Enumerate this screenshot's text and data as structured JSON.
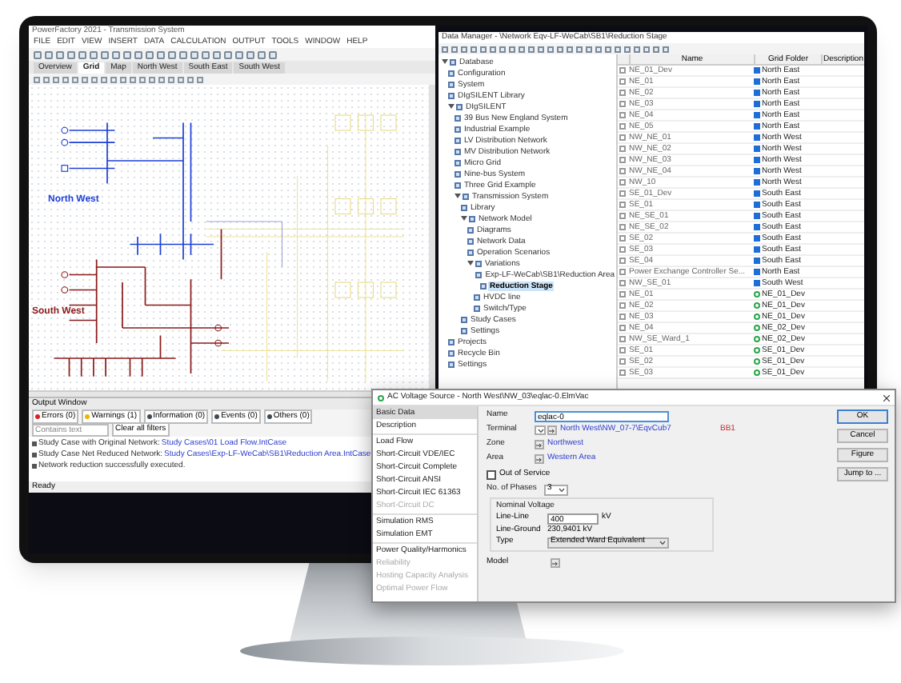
{
  "main_window": {
    "title": "PowerFactory 2021 - Transmission System",
    "menu": [
      "FILE",
      "EDIT",
      "VIEW",
      "INSERT",
      "DATA",
      "CALCULATION",
      "OUTPUT",
      "TOOLS",
      "WINDOW",
      "HELP"
    ],
    "tabs": [
      {
        "label": "Overview",
        "selected": false
      },
      {
        "label": "Grid",
        "selected": true
      },
      {
        "label": "Map",
        "selected": false
      },
      {
        "label": "North West",
        "selected": false
      },
      {
        "label": "South East",
        "selected": false
      },
      {
        "label": "South West",
        "selected": false
      }
    ],
    "diagram_labels": [
      {
        "text": "North West",
        "color": "#1d3fd6"
      },
      {
        "text": "South West",
        "color": "#8b1a1a"
      }
    ],
    "output": {
      "title": "Output Window",
      "filters": [
        {
          "label": "Errors (0)",
          "color": "#e02020"
        },
        {
          "label": "Warnings (1)",
          "color": "#f0b400"
        },
        {
          "label": "Information (0)",
          "color": "#404a55"
        },
        {
          "label": "Events (0)",
          "color": "#404a55"
        },
        {
          "label": "Others (0)",
          "color": "#404a55"
        }
      ],
      "search_placeholder": "Contains text",
      "clear": "Clear all filters",
      "lines": [
        {
          "text": "Study Case with Original Network:",
          "link": "Study Cases\\01 Load Flow.IntCase"
        },
        {
          "text": "Study Case Net Reduced Network:",
          "link": "Study Cases\\Exp-LF-WeCab\\SB1\\Reduction Area.IntCase"
        },
        {
          "text": "Network reduction successfully executed."
        }
      ],
      "status": "Ready"
    }
  },
  "data_manager": {
    "title": "Data Manager - \\Network Eqv-LF-WeCab\\SB1\\Reduction Stage",
    "tree": [
      {
        "label": "Database",
        "expanded": true,
        "children": [
          {
            "label": "Configuration"
          },
          {
            "label": "System"
          },
          {
            "label": "DIgSILENT Library"
          },
          {
            "label": "DIgSILENT",
            "expanded": true,
            "children": [
              {
                "label": "39 Bus New England System"
              },
              {
                "label": "Industrial Example"
              },
              {
                "label": "LV Distribution Network"
              },
              {
                "label": "MV Distribution Network"
              },
              {
                "label": "Micro Grid"
              },
              {
                "label": "Nine-bus System"
              },
              {
                "label": "Three Grid Example"
              },
              {
                "label": "Transmission System",
                "expanded": true,
                "children": [
                  {
                    "label": "Library"
                  },
                  {
                    "label": "Network Model",
                    "expanded": true,
                    "children": [
                      {
                        "label": "Diagrams"
                      },
                      {
                        "label": "Network Data"
                      },
                      {
                        "label": "Operation Scenarios"
                      },
                      {
                        "label": "Variations",
                        "expanded": true,
                        "children": [
                          {
                            "label": "Exp-LF-WeCab\\SB1\\Reduction Area",
                            "expanded": true,
                            "children": [
                              {
                                "label": "Reduction Stage",
                                "selected": true
                              }
                            ]
                          },
                          {
                            "label": "HVDC line"
                          },
                          {
                            "label": "Switch/Type"
                          }
                        ]
                      }
                    ]
                  },
                  {
                    "label": "Study Cases"
                  },
                  {
                    "label": "Settings"
                  }
                ]
              }
            ]
          },
          {
            "label": "Projects"
          },
          {
            "label": "Recycle Bin"
          },
          {
            "label": "Settings"
          }
        ]
      }
    ],
    "columns": [
      "Name",
      "Grid Folder",
      "Description"
    ],
    "rows": [
      {
        "name": "NE_01_Dev",
        "folder": "North East",
        "kind": "grid"
      },
      {
        "name": "NE_01",
        "folder": "North East",
        "kind": "grid"
      },
      {
        "name": "NE_02",
        "folder": "North East",
        "kind": "grid"
      },
      {
        "name": "NE_03",
        "folder": "North East",
        "kind": "grid"
      },
      {
        "name": "NE_04",
        "folder": "North East",
        "kind": "grid"
      },
      {
        "name": "NE_05",
        "folder": "North East",
        "kind": "grid"
      },
      {
        "name": "NW_NE_01",
        "folder": "North West",
        "kind": "grid"
      },
      {
        "name": "NW_NE_02",
        "folder": "North West",
        "kind": "grid"
      },
      {
        "name": "NW_NE_03",
        "folder": "North West",
        "kind": "grid"
      },
      {
        "name": "NW_NE_04",
        "folder": "North West",
        "kind": "grid"
      },
      {
        "name": "NW_10",
        "folder": "North West",
        "kind": "grid"
      },
      {
        "name": "SE_01_Dev",
        "folder": "South East",
        "kind": "grid"
      },
      {
        "name": "SE_01",
        "folder": "South East",
        "kind": "grid"
      },
      {
        "name": "NE_SE_01",
        "folder": "South East",
        "kind": "grid"
      },
      {
        "name": "NE_SE_02",
        "folder": "South East",
        "kind": "grid"
      },
      {
        "name": "SE_02",
        "folder": "South East",
        "kind": "grid"
      },
      {
        "name": "SE_03",
        "folder": "South East",
        "kind": "grid"
      },
      {
        "name": "SE_04",
        "folder": "South East",
        "kind": "grid"
      },
      {
        "name": "Power Exchange Controller Se...",
        "folder": "North East",
        "kind": "grid"
      },
      {
        "name": "NW_SE_01",
        "folder": "South West",
        "kind": "grid"
      },
      {
        "name": "NE_01",
        "folder": "NE_01_Dev",
        "kind": "variant"
      },
      {
        "name": "NE_02",
        "folder": "NE_01_Dev",
        "kind": "variant"
      },
      {
        "name": "NE_03",
        "folder": "NE_01_Dev",
        "kind": "variant"
      },
      {
        "name": "NE_04",
        "folder": "NE_02_Dev",
        "kind": "variant"
      },
      {
        "name": "NW_SE_Ward_1",
        "folder": "NE_02_Dev",
        "kind": "variant"
      },
      {
        "name": "SE_01",
        "folder": "SE_01_Dev",
        "kind": "variant"
      },
      {
        "name": "SE_02",
        "folder": "SE_01_Dev",
        "kind": "variant"
      },
      {
        "name": "SE_03",
        "folder": "SE_01_Dev",
        "kind": "variant"
      }
    ]
  },
  "dialog": {
    "title": "AC Voltage Source - North West\\NW_03\\eqlac-0.ElmVac",
    "nav": [
      {
        "label": "Basic Data",
        "selected": true,
        "disabled": false
      },
      {
        "label": "Description",
        "selected": false,
        "disabled": false
      },
      {
        "label": "Load Flow",
        "selected": false,
        "disabled": false
      },
      {
        "label": "Short-Circuit VDE/IEC",
        "selected": false,
        "disabled": false
      },
      {
        "label": "Short-Circuit Complete",
        "selected": false,
        "disabled": false
      },
      {
        "label": "Short-Circuit ANSI",
        "selected": false,
        "disabled": false
      },
      {
        "label": "Short-Circuit IEC 61363",
        "selected": false,
        "disabled": false
      },
      {
        "label": "Short-Circuit DC",
        "selected": false,
        "disabled": true
      },
      {
        "label": "Simulation RMS",
        "selected": false,
        "disabled": false
      },
      {
        "label": "Simulation EMT",
        "selected": false,
        "disabled": false
      },
      {
        "label": "Power Quality/Harmonics",
        "selected": false,
        "disabled": false
      },
      {
        "label": "Reliability",
        "selected": false,
        "disabled": true
      },
      {
        "label": "Hosting Capacity Analysis",
        "selected": false,
        "disabled": true
      },
      {
        "label": "Optimal Power Flow",
        "selected": false,
        "disabled": true
      }
    ],
    "name": {
      "label": "Name",
      "value": "eqlac-0"
    },
    "terminal": {
      "label": "Terminal",
      "value": "North West\\NW_07-7\\EqvCub7",
      "bus": "BB1"
    },
    "zone": {
      "label": "Zone",
      "value": "Northwest"
    },
    "area": {
      "label": "Area",
      "value": "Western Area"
    },
    "out_of_service": {
      "label": "Out of Service",
      "checked": false
    },
    "phases": {
      "label": "No. of Phases",
      "value": "3"
    },
    "nominal_voltage": {
      "title": "Nominal Voltage",
      "line_line": {
        "label": "Line-Line",
        "value": "400",
        "unit": "kV"
      },
      "line_ground": {
        "label": "Line-Ground",
        "value": "230,9401 kV"
      },
      "type": {
        "label": "Type",
        "value": "Extended Ward Equivalent"
      }
    },
    "model": {
      "label": "Model"
    },
    "buttons": [
      "OK",
      "Cancel",
      "Figure",
      "Jump to ..."
    ]
  }
}
